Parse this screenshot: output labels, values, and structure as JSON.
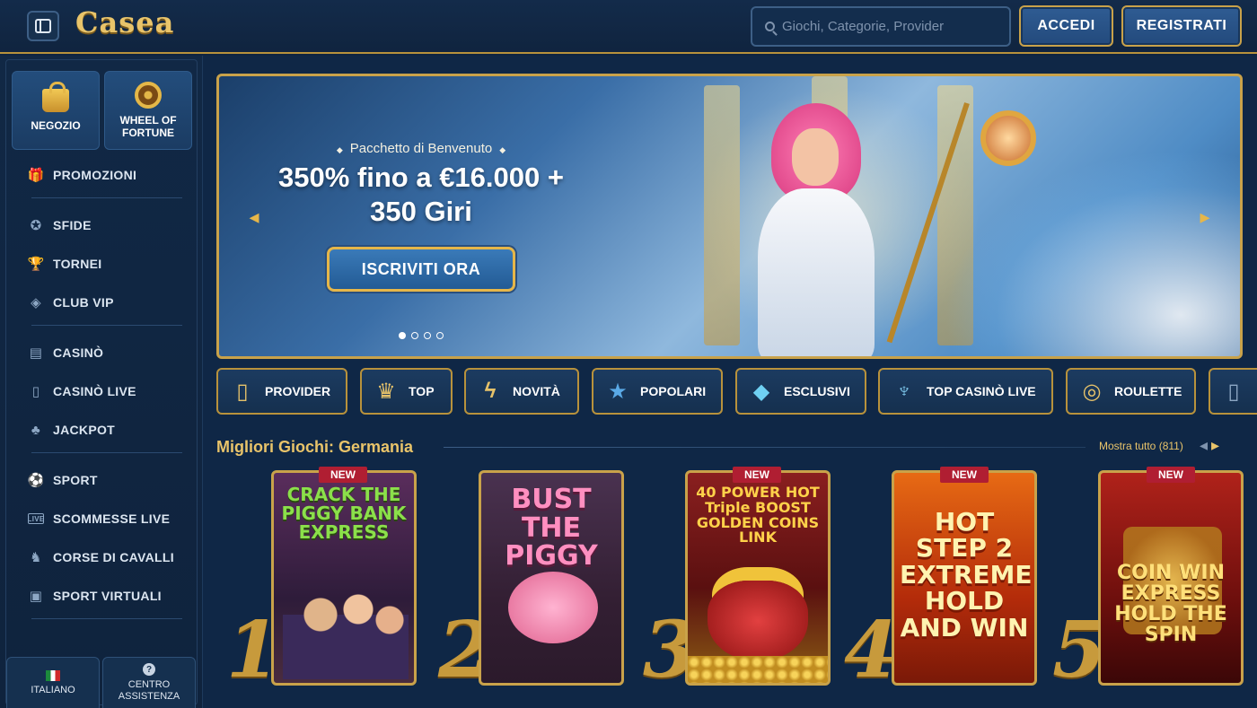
{
  "header": {
    "logo": "Casea",
    "search_placeholder": "Giochi, Categorie, Provider",
    "login_label": "ACCEDI",
    "register_label": "REGISTRATI"
  },
  "sidebar": {
    "tiles": [
      {
        "label": "NEGOZIO",
        "icon": "shopping-bag-icon"
      },
      {
        "label": "WHEEL OF FORTUNE",
        "icon": "wheel-icon"
      }
    ],
    "items": [
      {
        "label": "PROMOZIONI",
        "icon": "gift-icon"
      },
      {
        "label": "SFIDE",
        "icon": "medal-icon"
      },
      {
        "label": "TORNEI",
        "icon": "trophy-icon"
      },
      {
        "label": "CLUB VIP",
        "icon": "diamond-icon"
      },
      {
        "label": "CASINÒ",
        "icon": "slot-machine-icon"
      },
      {
        "label": "CASINÒ LIVE",
        "icon": "cards-icon"
      },
      {
        "label": "JACKPOT",
        "icon": "clover-icon"
      },
      {
        "label": "SPORT",
        "icon": "ball-icon"
      },
      {
        "label": "SCOMMESSE LIVE",
        "icon": "live-icon"
      },
      {
        "label": "CORSE DI CAVALLI",
        "icon": "horse-icon"
      },
      {
        "label": "SPORT VIRTUALI",
        "icon": "virtual-sport-icon"
      }
    ],
    "language": "ITALIANO",
    "help_center": "CENTRO ASSISTENZA"
  },
  "banner": {
    "subtitle": "Pacchetto di Benvenuto",
    "headline": "350% fino a €16.000 + 350 Giri",
    "cta": "ISCRIVITI ORA",
    "dots": 4,
    "active_dot": 1
  },
  "categories": [
    {
      "label": "PROVIDER",
      "icon": "card-icon"
    },
    {
      "label": "TOP",
      "icon": "crown-icon"
    },
    {
      "label": "NOVITÀ",
      "icon": "lightning-icon"
    },
    {
      "label": "POPOLARI",
      "icon": "star-icon"
    },
    {
      "label": "ESCLUSIVI",
      "icon": "gem-icon"
    },
    {
      "label": "TOP CASINÒ LIVE",
      "icon": "torch-icon"
    },
    {
      "label": "ROULETTE",
      "icon": "roulette-icon"
    }
  ],
  "section": {
    "title": "Migliori Giochi: Germania",
    "show_all": "Mostra tutto (811)"
  },
  "games": [
    {
      "rank": "1",
      "badge": "NEW",
      "title": "CRACK THE PIGGY BANK EXPRESS"
    },
    {
      "rank": "2",
      "badge": "",
      "title": "BUST THE PIGGY"
    },
    {
      "rank": "3",
      "badge": "NEW",
      "title": "40 POWER HOT Triple BOOST GOLDEN COINS LINK"
    },
    {
      "rank": "4",
      "badge": "NEW",
      "title": "HOT STEP 2 EXTREME HOLD AND WIN"
    },
    {
      "rank": "5",
      "badge": "NEW",
      "title": "COIN WIN EXPRESS HOLD THE SPIN"
    }
  ]
}
